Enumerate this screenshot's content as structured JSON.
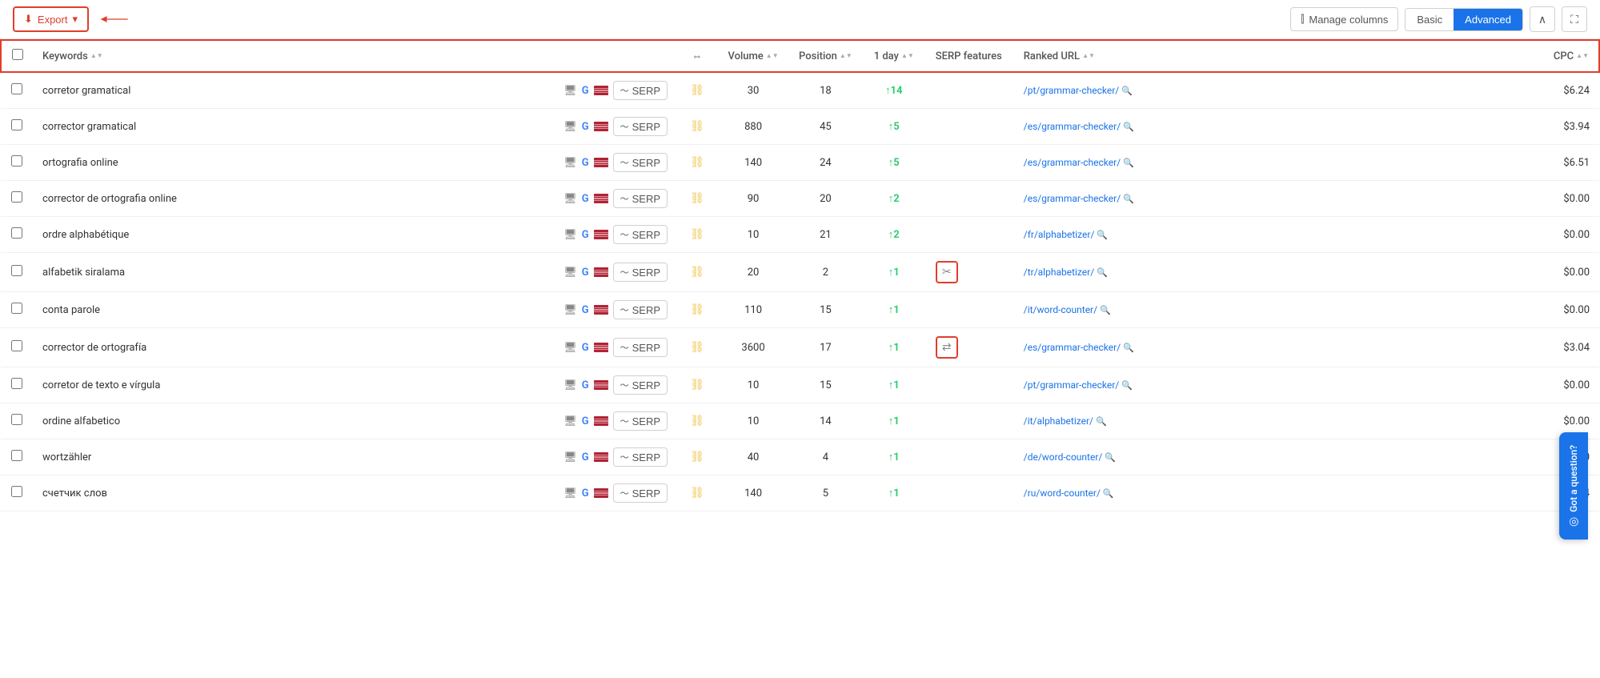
{
  "toolbar": {
    "export_label": "Export",
    "manage_columns_label": "Manage columns",
    "view_basic_label": "Basic",
    "view_advanced_label": "Advanced"
  },
  "table": {
    "headers": {
      "keywords": "Keywords",
      "volume": "Volume",
      "position": "Position",
      "oneday": "1 day",
      "serp_features": "SERP features",
      "ranked_url": "Ranked URL",
      "cpc": "CPC"
    },
    "rows": [
      {
        "keyword": "corretor gramatical",
        "volume": "30",
        "position": "18",
        "oneday": "14",
        "oneday_dir": "up",
        "serp_feature": "",
        "ranked_url": "/pt/grammar-checker/",
        "cpc": "$6.24"
      },
      {
        "keyword": "corrector gramatical",
        "volume": "880",
        "position": "45",
        "oneday": "5",
        "oneday_dir": "up",
        "serp_feature": "",
        "ranked_url": "/es/grammar-checker/",
        "cpc": "$3.94"
      },
      {
        "keyword": "ortografia online",
        "volume": "140",
        "position": "24",
        "oneday": "5",
        "oneday_dir": "up",
        "serp_feature": "",
        "ranked_url": "/es/grammar-checker/",
        "cpc": "$6.51"
      },
      {
        "keyword": "corrector de ortografia online",
        "volume": "90",
        "position": "20",
        "oneday": "2",
        "oneday_dir": "up",
        "serp_feature": "",
        "ranked_url": "/es/grammar-checker/",
        "cpc": "$0.00"
      },
      {
        "keyword": "ordre alphabétique",
        "volume": "10",
        "position": "21",
        "oneday": "2",
        "oneday_dir": "up",
        "serp_feature": "",
        "ranked_url": "/fr/alphabetizer/",
        "cpc": "$0.00"
      },
      {
        "keyword": "alfabetik siralama",
        "volume": "20",
        "position": "2",
        "oneday": "1",
        "oneday_dir": "up",
        "serp_feature": "scissors",
        "ranked_url": "/tr/alphabetizer/",
        "cpc": "$0.00"
      },
      {
        "keyword": "conta parole",
        "volume": "110",
        "position": "15",
        "oneday": "1",
        "oneday_dir": "up",
        "serp_feature": "",
        "ranked_url": "/it/word-counter/",
        "cpc": "$0.00"
      },
      {
        "keyword": "corrector de ortografía",
        "volume": "3600",
        "position": "17",
        "oneday": "1",
        "oneday_dir": "up",
        "serp_feature": "arrows",
        "ranked_url": "/es/grammar-checker/",
        "cpc": "$3.04"
      },
      {
        "keyword": "corretor de texto e vírgula",
        "volume": "10",
        "position": "15",
        "oneday": "1",
        "oneday_dir": "up",
        "serp_feature": "",
        "ranked_url": "/pt/grammar-checker/",
        "cpc": "$0.00"
      },
      {
        "keyword": "ordine alfabetico",
        "volume": "10",
        "position": "14",
        "oneday": "1",
        "oneday_dir": "up",
        "serp_feature": "",
        "ranked_url": "/it/alphabetizer/",
        "cpc": "$0.00"
      },
      {
        "keyword": "wortzähler",
        "volume": "40",
        "position": "4",
        "oneday": "1",
        "oneday_dir": "up",
        "serp_feature": "",
        "ranked_url": "/de/word-counter/",
        "cpc": "$0.00"
      },
      {
        "keyword": "счетчик слов",
        "volume": "140",
        "position": "5",
        "oneday": "1",
        "oneday_dir": "up",
        "serp_feature": "",
        "ranked_url": "/ru/word-counter/",
        "cpc": "$0.04"
      }
    ]
  },
  "got_question": "Got a question?"
}
